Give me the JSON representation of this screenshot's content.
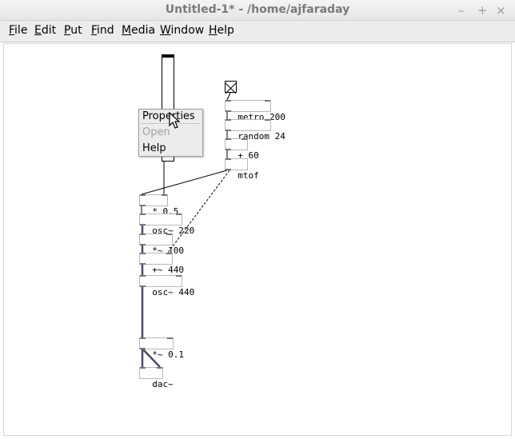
{
  "window": {
    "title": "Untitled-1* - /home/ajfaraday",
    "controls": {
      "minimize": "–",
      "maximize": "+",
      "close": "×"
    }
  },
  "menubar": [
    {
      "label": "File",
      "mnemonic": "F",
      "rest": "ile"
    },
    {
      "label": "Edit",
      "mnemonic": "E",
      "rest": "dit"
    },
    {
      "label": "Put",
      "mnemonic": "P",
      "rest": "ut"
    },
    {
      "label": "Find",
      "mnemonic": "F",
      "rest": "ind"
    },
    {
      "label": "Media",
      "mnemonic": "M",
      "rest": "edia"
    },
    {
      "label": "Window",
      "mnemonic": "W",
      "rest": "indow"
    },
    {
      "label": "Help",
      "mnemonic": "H",
      "rest": "elp"
    }
  ],
  "context_menu": {
    "items": [
      {
        "label": "Properties",
        "enabled": true
      },
      {
        "label": "Open",
        "enabled": false
      },
      {
        "label": "Help",
        "enabled": true
      }
    ]
  },
  "patch": {
    "objects": {
      "metro": "metro 200",
      "random": "random 24",
      "plus": "+ 60",
      "mtof": "mtof",
      "mul": "* 0.5",
      "osc1": "osc~ 220",
      "mul2": "*~ 100",
      "add": "+~ 440",
      "osc2": "osc~ 440",
      "gain": "*~ 0.1",
      "dac": "dac~"
    },
    "icons": {
      "bang": "bang-gui-icon",
      "slider": "vertical-slider-icon",
      "cursor": "mouse-pointer-icon"
    }
  }
}
